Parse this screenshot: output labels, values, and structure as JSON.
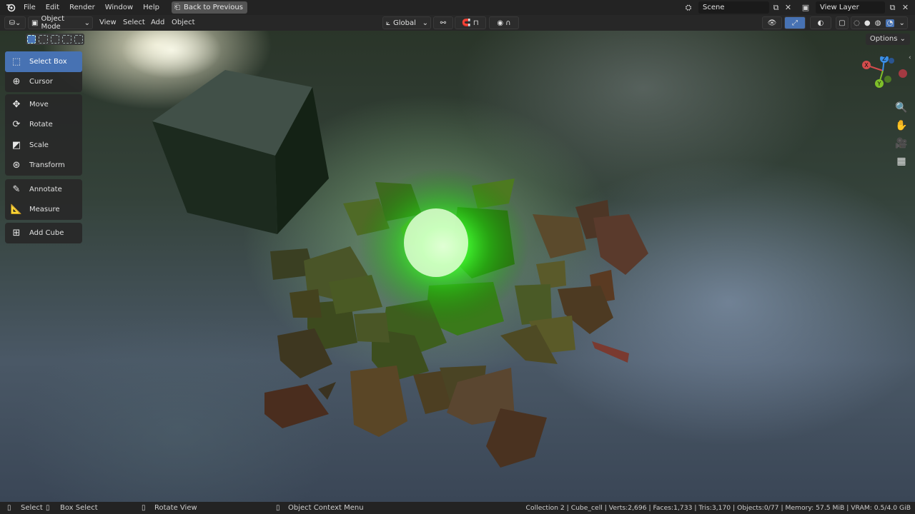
{
  "topbar": {
    "menus": [
      "File",
      "Edit",
      "Render",
      "Window",
      "Help"
    ],
    "back_button": "Back to Previous",
    "scene": "Scene",
    "view_layer": "View Layer"
  },
  "header": {
    "mode": "Object Mode",
    "menus": [
      "View",
      "Select",
      "Add",
      "Object"
    ],
    "orientation": "Global"
  },
  "tools": {
    "group1": [
      {
        "label": "Select Box",
        "icon": "select-box-icon",
        "active": true
      },
      {
        "label": "Cursor",
        "icon": "cursor-icon"
      }
    ],
    "group2": [
      {
        "label": "Move",
        "icon": "move-icon"
      },
      {
        "label": "Rotate",
        "icon": "rotate-icon"
      },
      {
        "label": "Scale",
        "icon": "scale-icon"
      },
      {
        "label": "Transform",
        "icon": "transform-icon"
      }
    ],
    "group3": [
      {
        "label": "Annotate",
        "icon": "annotate-icon"
      },
      {
        "label": "Measure",
        "icon": "measure-icon"
      }
    ],
    "group4": [
      {
        "label": "Add Cube",
        "icon": "add-cube-icon"
      }
    ]
  },
  "options_label": "Options",
  "gizmo": {
    "x": "X",
    "y": "Y",
    "z": "Z"
  },
  "status": {
    "select": "Select",
    "box_select": "Box Select",
    "rotate_view": "Rotate View",
    "context_menu": "Object Context Menu",
    "stats": "Collection 2 | Cube_cell | Verts:2,696 | Faces:1,733 | Tris:3,170 | Objects:0/77 | Memory: 57.5 MiB | VRAM: 0.5/4.0 GiB"
  },
  "colors": {
    "accent": "#4772b3",
    "glow": "#2bff2b",
    "x_axis": "#d44c4c",
    "y_axis": "#7fbf2a",
    "z_axis": "#3a8ee6"
  }
}
